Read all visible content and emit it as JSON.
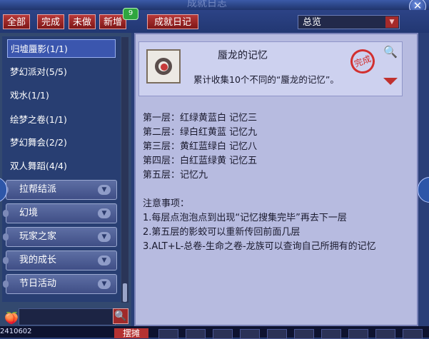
{
  "window": {
    "title": "成就日志",
    "close_glyph": "✕"
  },
  "filters": {
    "all": "全部",
    "done": "完成",
    "undone": "未做",
    "new": "新增",
    "new_count": "9"
  },
  "journal_button": "成就日记",
  "view_select": {
    "value": "总览",
    "arrow": "▼"
  },
  "achievements": [
    {
      "label": "归墟蜃影(1/1)",
      "selected": true
    },
    {
      "label": "梦幻派对(5/5)"
    },
    {
      "label": "戏水(1/1)"
    },
    {
      "label": "绘梦之卷(1/1)"
    },
    {
      "label": "梦幻舞会(2/2)"
    },
    {
      "label": "双人舞蹈(4/4)"
    }
  ],
  "categories": [
    {
      "label": "拉帮结派"
    },
    {
      "label": "幻境"
    },
    {
      "label": "玩家之家"
    },
    {
      "label": "我的成长"
    },
    {
      "label": "节日活动"
    }
  ],
  "search": {
    "placeholder": "",
    "button_glyph": "🔍",
    "avatar_glyph": "🍑"
  },
  "detail": {
    "title": "蜃龙的记忆",
    "description": "累计收集10个不同的“蜃龙的记忆”。",
    "stamp_text": "完成",
    "lines": [
      "第一层：红绿黄蓝白  记忆三",
      "第二层：绿白红黄蓝  记忆九",
      "第三层：黄红蓝绿白  记忆八",
      "第四层：白红蓝绿黄  记忆五",
      "第五层：记忆九",
      "",
      "注意事项：",
      "1.每层点泡泡点到出现“记忆搜集完毕”再去下一层",
      "2.第五层的影蛟可以重新传回前面几层",
      "3.ALT+L-总卷-生命之卷-龙族可以查询自己所拥有的记忆"
    ]
  },
  "bottom": {
    "number": "2410602",
    "button": "摆摊"
  },
  "colors": {
    "accent_red": "#a52a2a",
    "panel_blue": "#2a3f78",
    "content_bg": "#b7bbe0"
  }
}
